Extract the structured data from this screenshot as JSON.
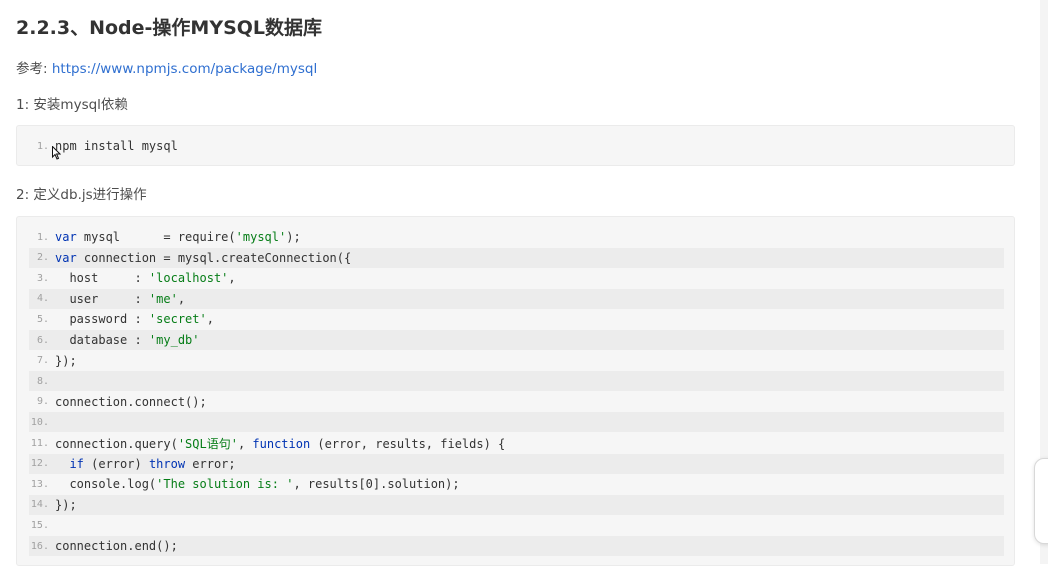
{
  "page": {
    "heading": "2.2.3、Node-操作MYSQL数据库",
    "reference_label": "参考:",
    "reference_link": "https://www.npmjs.com/package/mysql",
    "step1": "1: 安装mysql依赖",
    "step2": "2: 定义db.js进行操作"
  },
  "code_blocks": [
    {
      "lines": [
        {
          "num": "1.",
          "tokens": [
            {
              "t": "npm install mysql",
              "c": ""
            }
          ]
        }
      ]
    },
    {
      "lines": [
        {
          "num": "1.",
          "tokens": [
            {
              "t": "var",
              "c": "kw"
            },
            {
              "t": " mysql      = require(",
              "c": ""
            },
            {
              "t": "'mysql'",
              "c": "str"
            },
            {
              "t": ");",
              "c": ""
            }
          ]
        },
        {
          "num": "2.",
          "tokens": [
            {
              "t": "var",
              "c": "kw"
            },
            {
              "t": " connection = mysql.createConnection({",
              "c": ""
            }
          ]
        },
        {
          "num": "3.",
          "tokens": [
            {
              "t": "  host     : ",
              "c": ""
            },
            {
              "t": "'localhost'",
              "c": "str"
            },
            {
              "t": ",",
              "c": ""
            }
          ]
        },
        {
          "num": "4.",
          "tokens": [
            {
              "t": "  user     : ",
              "c": ""
            },
            {
              "t": "'me'",
              "c": "str"
            },
            {
              "t": ",",
              "c": ""
            }
          ]
        },
        {
          "num": "5.",
          "tokens": [
            {
              "t": "  password : ",
              "c": ""
            },
            {
              "t": "'secret'",
              "c": "str"
            },
            {
              "t": ",",
              "c": ""
            }
          ]
        },
        {
          "num": "6.",
          "tokens": [
            {
              "t": "  database : ",
              "c": ""
            },
            {
              "t": "'my_db'",
              "c": "str"
            }
          ]
        },
        {
          "num": "7.",
          "tokens": [
            {
              "t": "});",
              "c": ""
            }
          ]
        },
        {
          "num": "8.",
          "tokens": []
        },
        {
          "num": "9.",
          "tokens": [
            {
              "t": "connection.connect();",
              "c": ""
            }
          ]
        },
        {
          "num": "10.",
          "tokens": []
        },
        {
          "num": "11.",
          "tokens": [
            {
              "t": "connection.query(",
              "c": ""
            },
            {
              "t": "'SQL语句'",
              "c": "str"
            },
            {
              "t": ", ",
              "c": ""
            },
            {
              "t": "function",
              "c": "kw"
            },
            {
              "t": " (error, results, fields) {",
              "c": ""
            }
          ]
        },
        {
          "num": "12.",
          "tokens": [
            {
              "t": "  ",
              "c": ""
            },
            {
              "t": "if",
              "c": "kw"
            },
            {
              "t": " (error) ",
              "c": ""
            },
            {
              "t": "throw",
              "c": "kw"
            },
            {
              "t": " error;",
              "c": ""
            }
          ]
        },
        {
          "num": "13.",
          "tokens": [
            {
              "t": "  console.log(",
              "c": ""
            },
            {
              "t": "'The solution is: '",
              "c": "str"
            },
            {
              "t": ", results[0].solution);",
              "c": ""
            }
          ]
        },
        {
          "num": "14.",
          "tokens": [
            {
              "t": "});",
              "c": ""
            }
          ]
        },
        {
          "num": "15.",
          "tokens": []
        },
        {
          "num": "16.",
          "tokens": [
            {
              "t": "connection.end();",
              "c": ""
            }
          ]
        }
      ]
    }
  ],
  "colors": {
    "link": "#2f6fd0",
    "keyword": "#0033b3",
    "string": "#067d17",
    "code_bg": "#f6f6f6",
    "stripe_bg": "#ececec"
  },
  "icons": {
    "cursor": "mouse-pointer-icon"
  }
}
